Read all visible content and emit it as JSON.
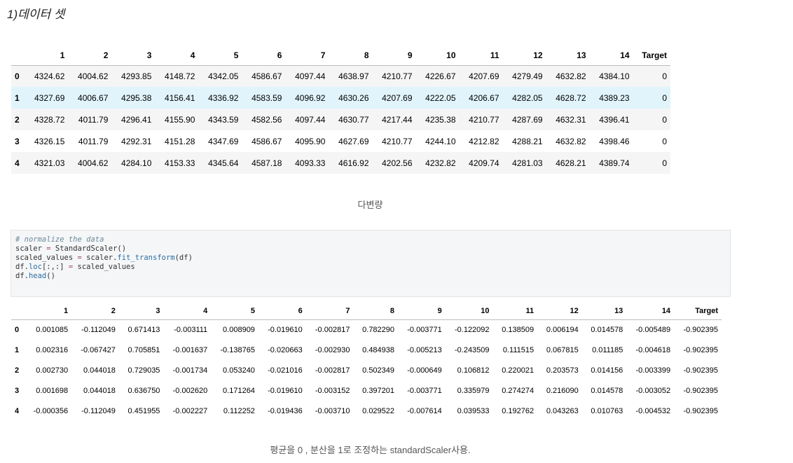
{
  "heading": "1)데이터 셋",
  "table1": {
    "columns": [
      "",
      "1",
      "2",
      "3",
      "4",
      "5",
      "6",
      "7",
      "8",
      "9",
      "10",
      "11",
      "12",
      "13",
      "14",
      "Target"
    ],
    "rows": [
      [
        "0",
        "4324.62",
        "4004.62",
        "4293.85",
        "4148.72",
        "4342.05",
        "4586.67",
        "4097.44",
        "4638.97",
        "4210.77",
        "4226.67",
        "4207.69",
        "4279.49",
        "4632.82",
        "4384.10",
        "0"
      ],
      [
        "1",
        "4327.69",
        "4006.67",
        "4295.38",
        "4156.41",
        "4336.92",
        "4583.59",
        "4096.92",
        "4630.26",
        "4207.69",
        "4222.05",
        "4206.67",
        "4282.05",
        "4628.72",
        "4389.23",
        "0"
      ],
      [
        "2",
        "4328.72",
        "4011.79",
        "4296.41",
        "4155.90",
        "4343.59",
        "4582.56",
        "4097.44",
        "4630.77",
        "4217.44",
        "4235.38",
        "4210.77",
        "4287.69",
        "4632.31",
        "4396.41",
        "0"
      ],
      [
        "3",
        "4326.15",
        "4011.79",
        "4292.31",
        "4151.28",
        "4347.69",
        "4586.67",
        "4095.90",
        "4627.69",
        "4210.77",
        "4244.10",
        "4212.82",
        "4288.21",
        "4632.82",
        "4398.46",
        "0"
      ],
      [
        "4",
        "4321.03",
        "4004.62",
        "4284.10",
        "4153.33",
        "4345.64",
        "4587.18",
        "4093.33",
        "4616.92",
        "4202.56",
        "4232.82",
        "4209.74",
        "4281.03",
        "4628.21",
        "4389.74",
        "0"
      ]
    ]
  },
  "caption1": "다변량",
  "code": {
    "comment": "# normalize the data",
    "line2_var": "scaler",
    "line2_op": " = ",
    "line2_val": "StandardScaler()",
    "line3_var": "scaled_values",
    "line3_op": " = ",
    "line3_obj": "scaler.",
    "line3_attr": "fit_transform",
    "line3_args": "(df)",
    "line4_obj": "df.",
    "line4_attr": "loc",
    "line4_idx": "[:,:]",
    "line4_op": " = ",
    "line4_val": "scaled_values",
    "line5_obj": "df.",
    "line5_attr": "head",
    "line5_args": "()"
  },
  "table2": {
    "columns": [
      "",
      "1",
      "2",
      "3",
      "4",
      "5",
      "6",
      "7",
      "8",
      "9",
      "10",
      "11",
      "12",
      "13",
      "14",
      "Target"
    ],
    "rows": [
      [
        "0",
        "0.001085",
        "-0.112049",
        "0.671413",
        "-0.003111",
        "0.008909",
        "-0.019610",
        "-0.002817",
        "0.782290",
        "-0.003771",
        "-0.122092",
        "0.138509",
        "0.006194",
        "0.014578",
        "-0.005489",
        "-0.902395"
      ],
      [
        "1",
        "0.002316",
        "-0.067427",
        "0.705851",
        "-0.001637",
        "-0.138765",
        "-0.020663",
        "-0.002930",
        "0.484938",
        "-0.005213",
        "-0.243509",
        "0.111515",
        "0.067815",
        "0.011185",
        "-0.004618",
        "-0.902395"
      ],
      [
        "2",
        "0.002730",
        "0.044018",
        "0.729035",
        "-0.001734",
        "0.053240",
        "-0.021016",
        "-0.002817",
        "0.502349",
        "-0.000649",
        "0.106812",
        "0.220021",
        "0.203573",
        "0.014156",
        "-0.003399",
        "-0.902395"
      ],
      [
        "3",
        "0.001698",
        "0.044018",
        "0.636750",
        "-0.002620",
        "0.171264",
        "-0.019610",
        "-0.003152",
        "0.397201",
        "-0.003771",
        "0.335979",
        "0.274274",
        "0.216090",
        "0.014578",
        "-0.003052",
        "-0.902395"
      ],
      [
        "4",
        "-0.000356",
        "-0.112049",
        "0.451955",
        "-0.002227",
        "0.112252",
        "-0.019436",
        "-0.003710",
        "0.029522",
        "-0.007614",
        "0.039533",
        "0.192762",
        "0.043263",
        "0.010763",
        "-0.004532",
        "-0.902395"
      ]
    ]
  },
  "caption2": "평균을 0 , 분산을 1로 조정하는 standardScaler사용."
}
